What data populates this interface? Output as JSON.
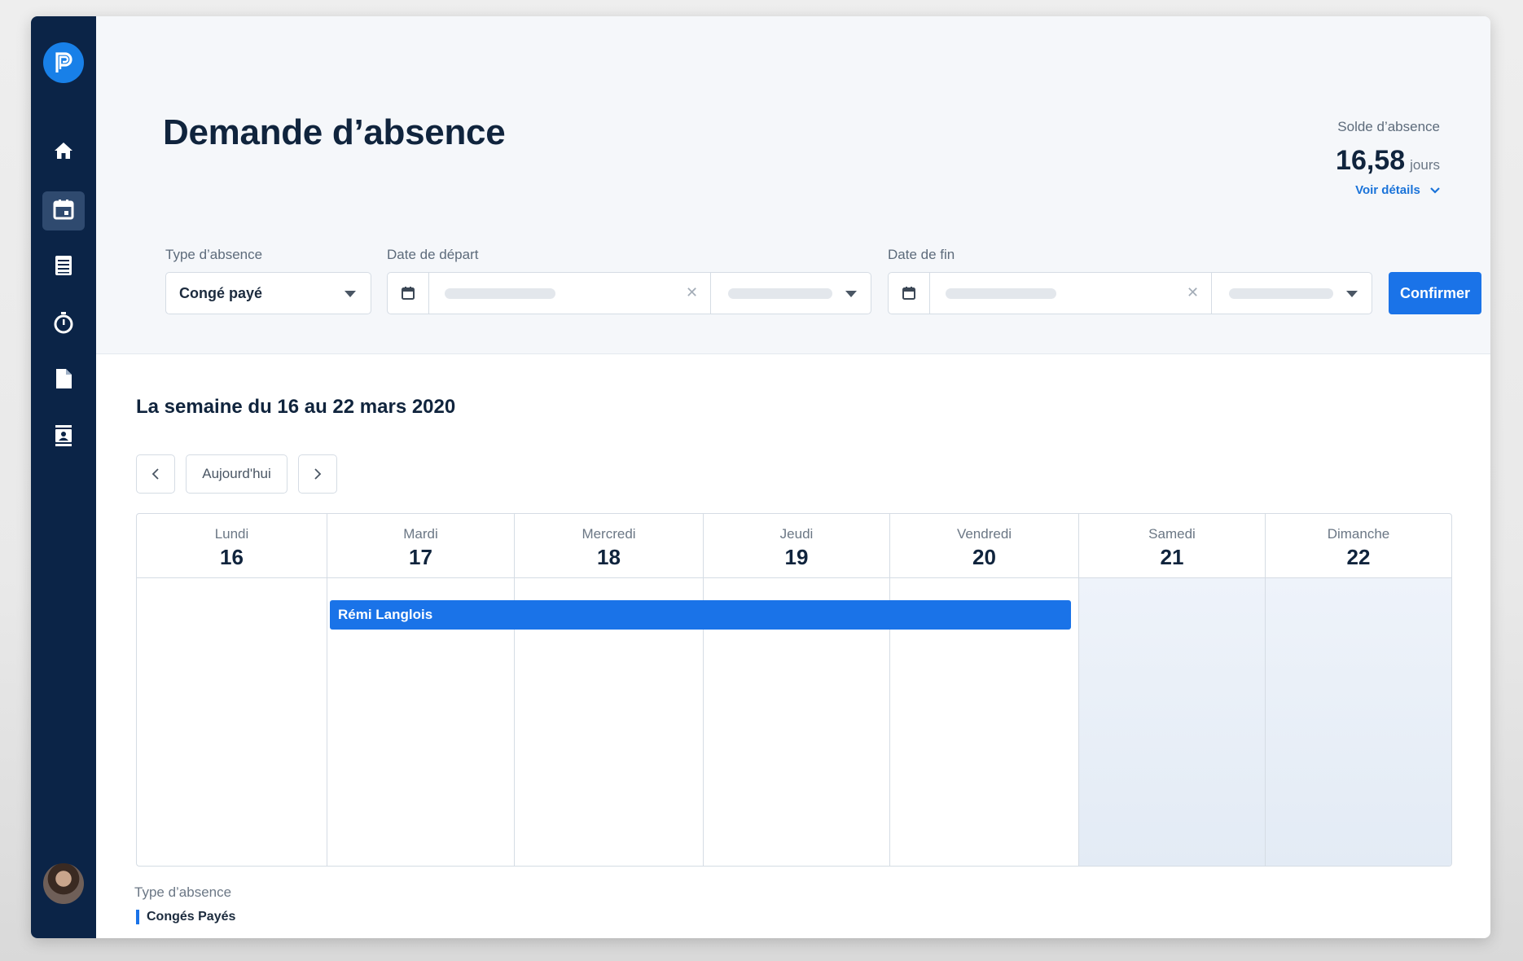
{
  "page": {
    "title": "Demande d’absence"
  },
  "sidebar": {
    "logo_icon": "p-logo-icon",
    "items": [
      {
        "name": "home",
        "icon": "home-icon",
        "active": false
      },
      {
        "name": "calendar",
        "icon": "calendar-icon",
        "active": true
      },
      {
        "name": "list",
        "icon": "list-icon",
        "active": false
      },
      {
        "name": "timer",
        "icon": "stopwatch-icon",
        "active": false
      },
      {
        "name": "document",
        "icon": "document-icon",
        "active": false
      },
      {
        "name": "contacts",
        "icon": "contact-book-icon",
        "active": false
      }
    ],
    "avatar_icon": "user-avatar"
  },
  "balance": {
    "label": "Solde d’absence",
    "value": "16,58",
    "unit": "jours",
    "details_link": "Voir détails"
  },
  "form": {
    "type_label": "Type d’absence",
    "type_value": "Congé payé",
    "start_label": "Date de départ",
    "end_label": "Date de fin",
    "confirm_label": "Confirmer"
  },
  "calendar": {
    "week_title": "La semaine du 16 au 22 mars 2020",
    "today_label": "Aujourd'hui",
    "days": [
      {
        "name": "Lundi",
        "num": "16"
      },
      {
        "name": "Mardi",
        "num": "17"
      },
      {
        "name": "Mercredi",
        "num": "18"
      },
      {
        "name": "Jeudi",
        "num": "19"
      },
      {
        "name": "Vendredi",
        "num": "20"
      },
      {
        "name": "Samedi",
        "num": "21"
      },
      {
        "name": "Dimanche",
        "num": "22"
      }
    ],
    "event": {
      "label": "Rémi Langlois",
      "color": "#1a73e8"
    }
  },
  "legend": {
    "title": "Type d’absence",
    "item": "Congés Payés",
    "color": "#1a73e8"
  },
  "colors": {
    "sidebar": "#0b2447",
    "accent": "#1a73e8",
    "weekend": "#e8eef6"
  }
}
